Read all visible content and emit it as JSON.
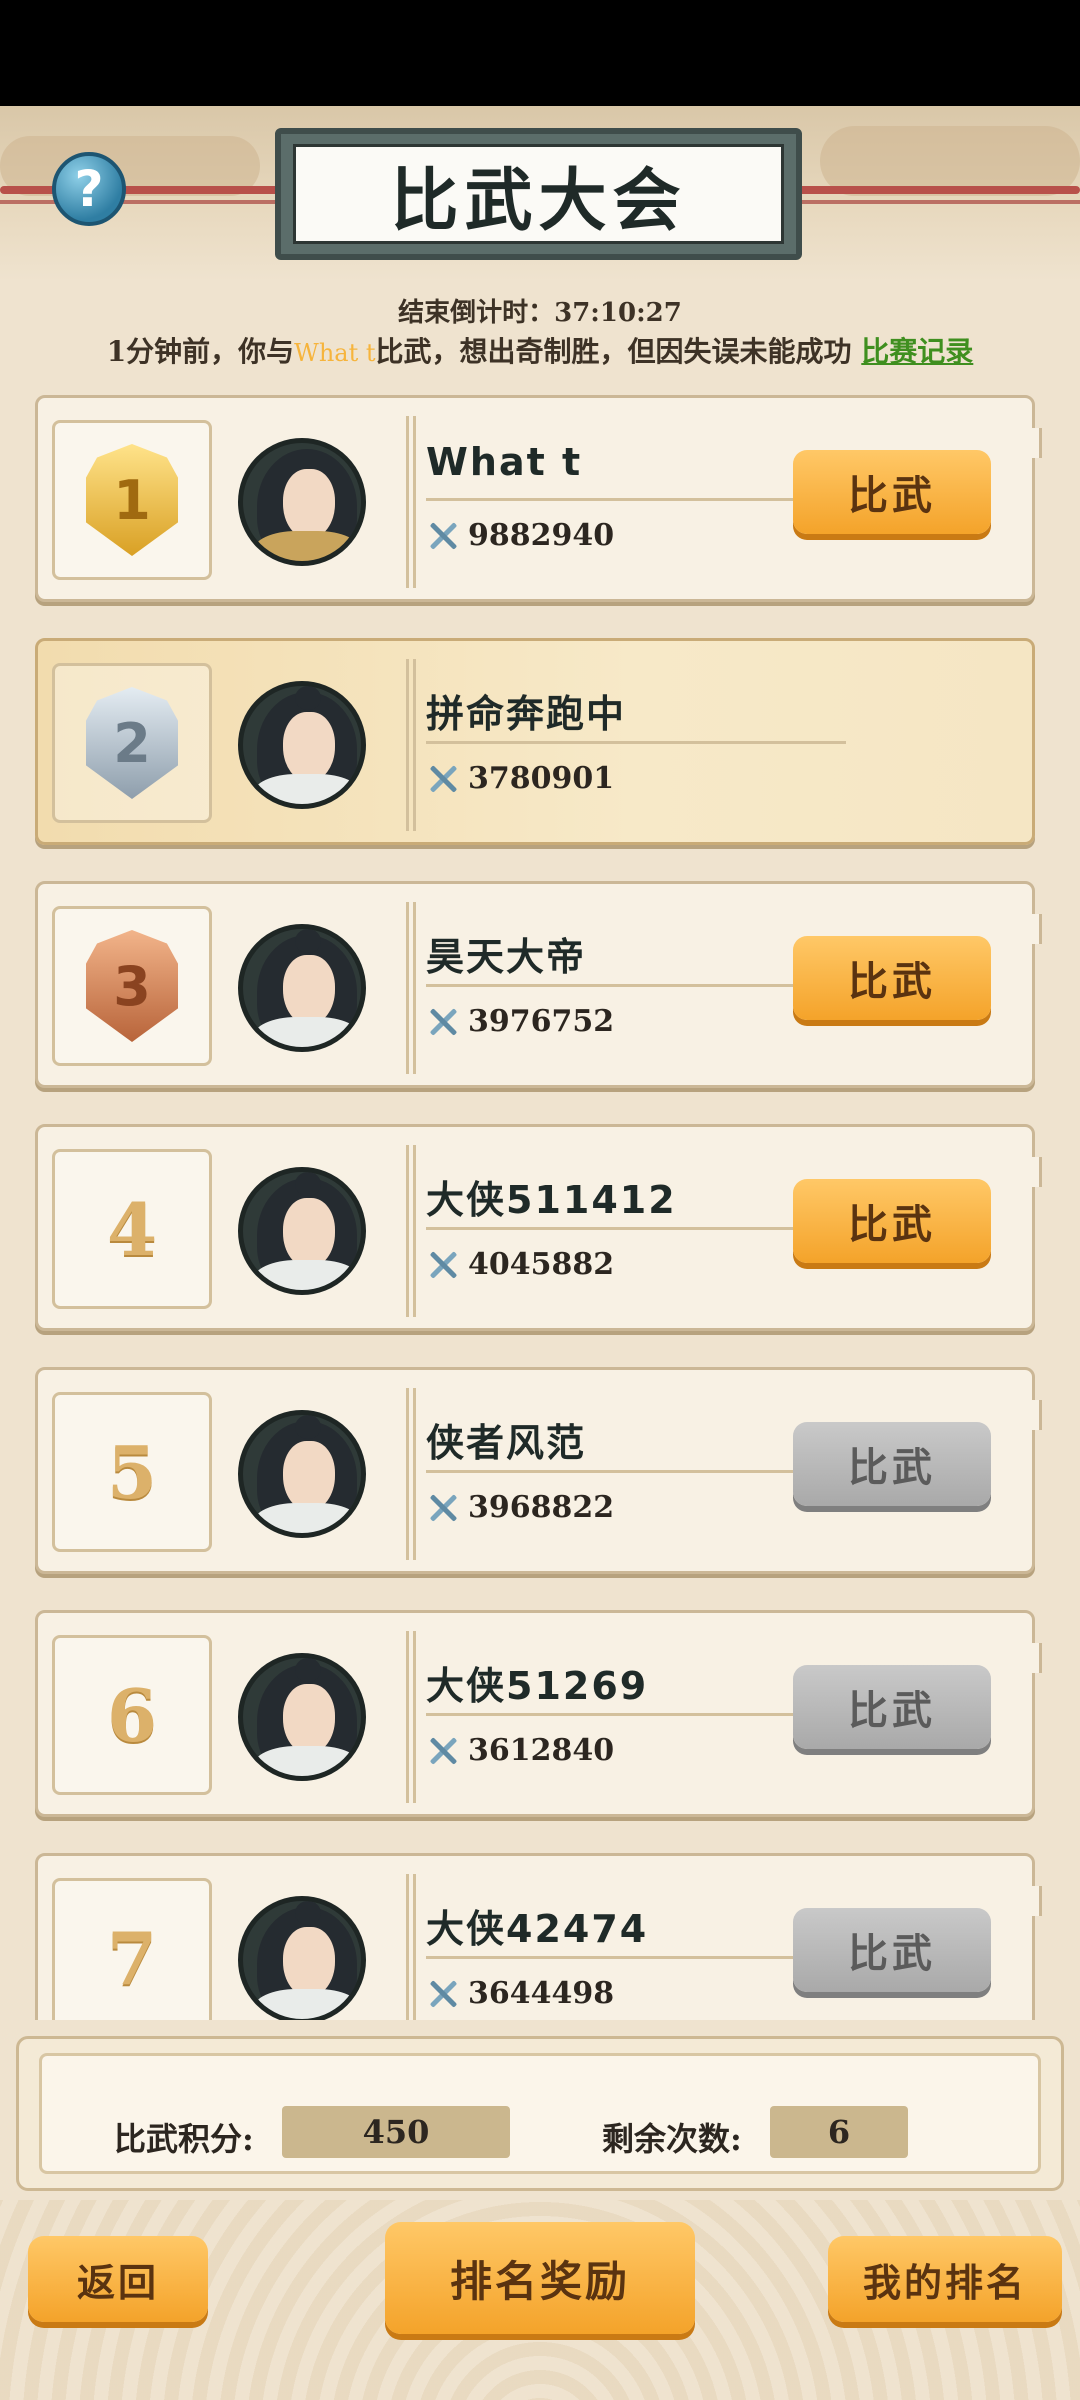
{
  "title": "比武大会",
  "countdown": "结束倒计时：37:10:27",
  "notice": {
    "prefix": "1分钟前，你与",
    "opponent": "What t",
    "suffix": "比武，想出奇制胜，但因失误未能成功 ",
    "link": "比赛记录"
  },
  "players": [
    {
      "rank": "1",
      "name": "What t",
      "power": "9882940",
      "button": "比武",
      "button_enabled": true
    },
    {
      "rank": "2",
      "name": "拼命奔跑中",
      "power": "3780901",
      "button": "",
      "button_enabled": false
    },
    {
      "rank": "3",
      "name": "昊天大帝",
      "power": "3976752",
      "button": "比武",
      "button_enabled": true
    },
    {
      "rank": "4",
      "name": "大侠511412",
      "power": "4045882",
      "button": "比武",
      "button_enabled": true
    },
    {
      "rank": "5",
      "name": "侠者风范",
      "power": "3968822",
      "button": "比武",
      "button_enabled": false
    },
    {
      "rank": "6",
      "name": "大侠51269",
      "power": "3612840",
      "button": "比武",
      "button_enabled": false
    },
    {
      "rank": "7",
      "name": "大侠42474",
      "power": "3644498",
      "button": "比武",
      "button_enabled": false
    }
  ],
  "score": {
    "points_label": "比武积分:",
    "points_value": "450",
    "remaining_label": "剩余次数:",
    "remaining_value": "6"
  },
  "buttons": {
    "back": "返回",
    "rewards": "排名奖励",
    "my_rank": "我的排名"
  },
  "colors": {
    "accent_orange": "#f4a32a",
    "link_green": "#3f8f1f",
    "highlight_gold": "#f6b43c"
  }
}
